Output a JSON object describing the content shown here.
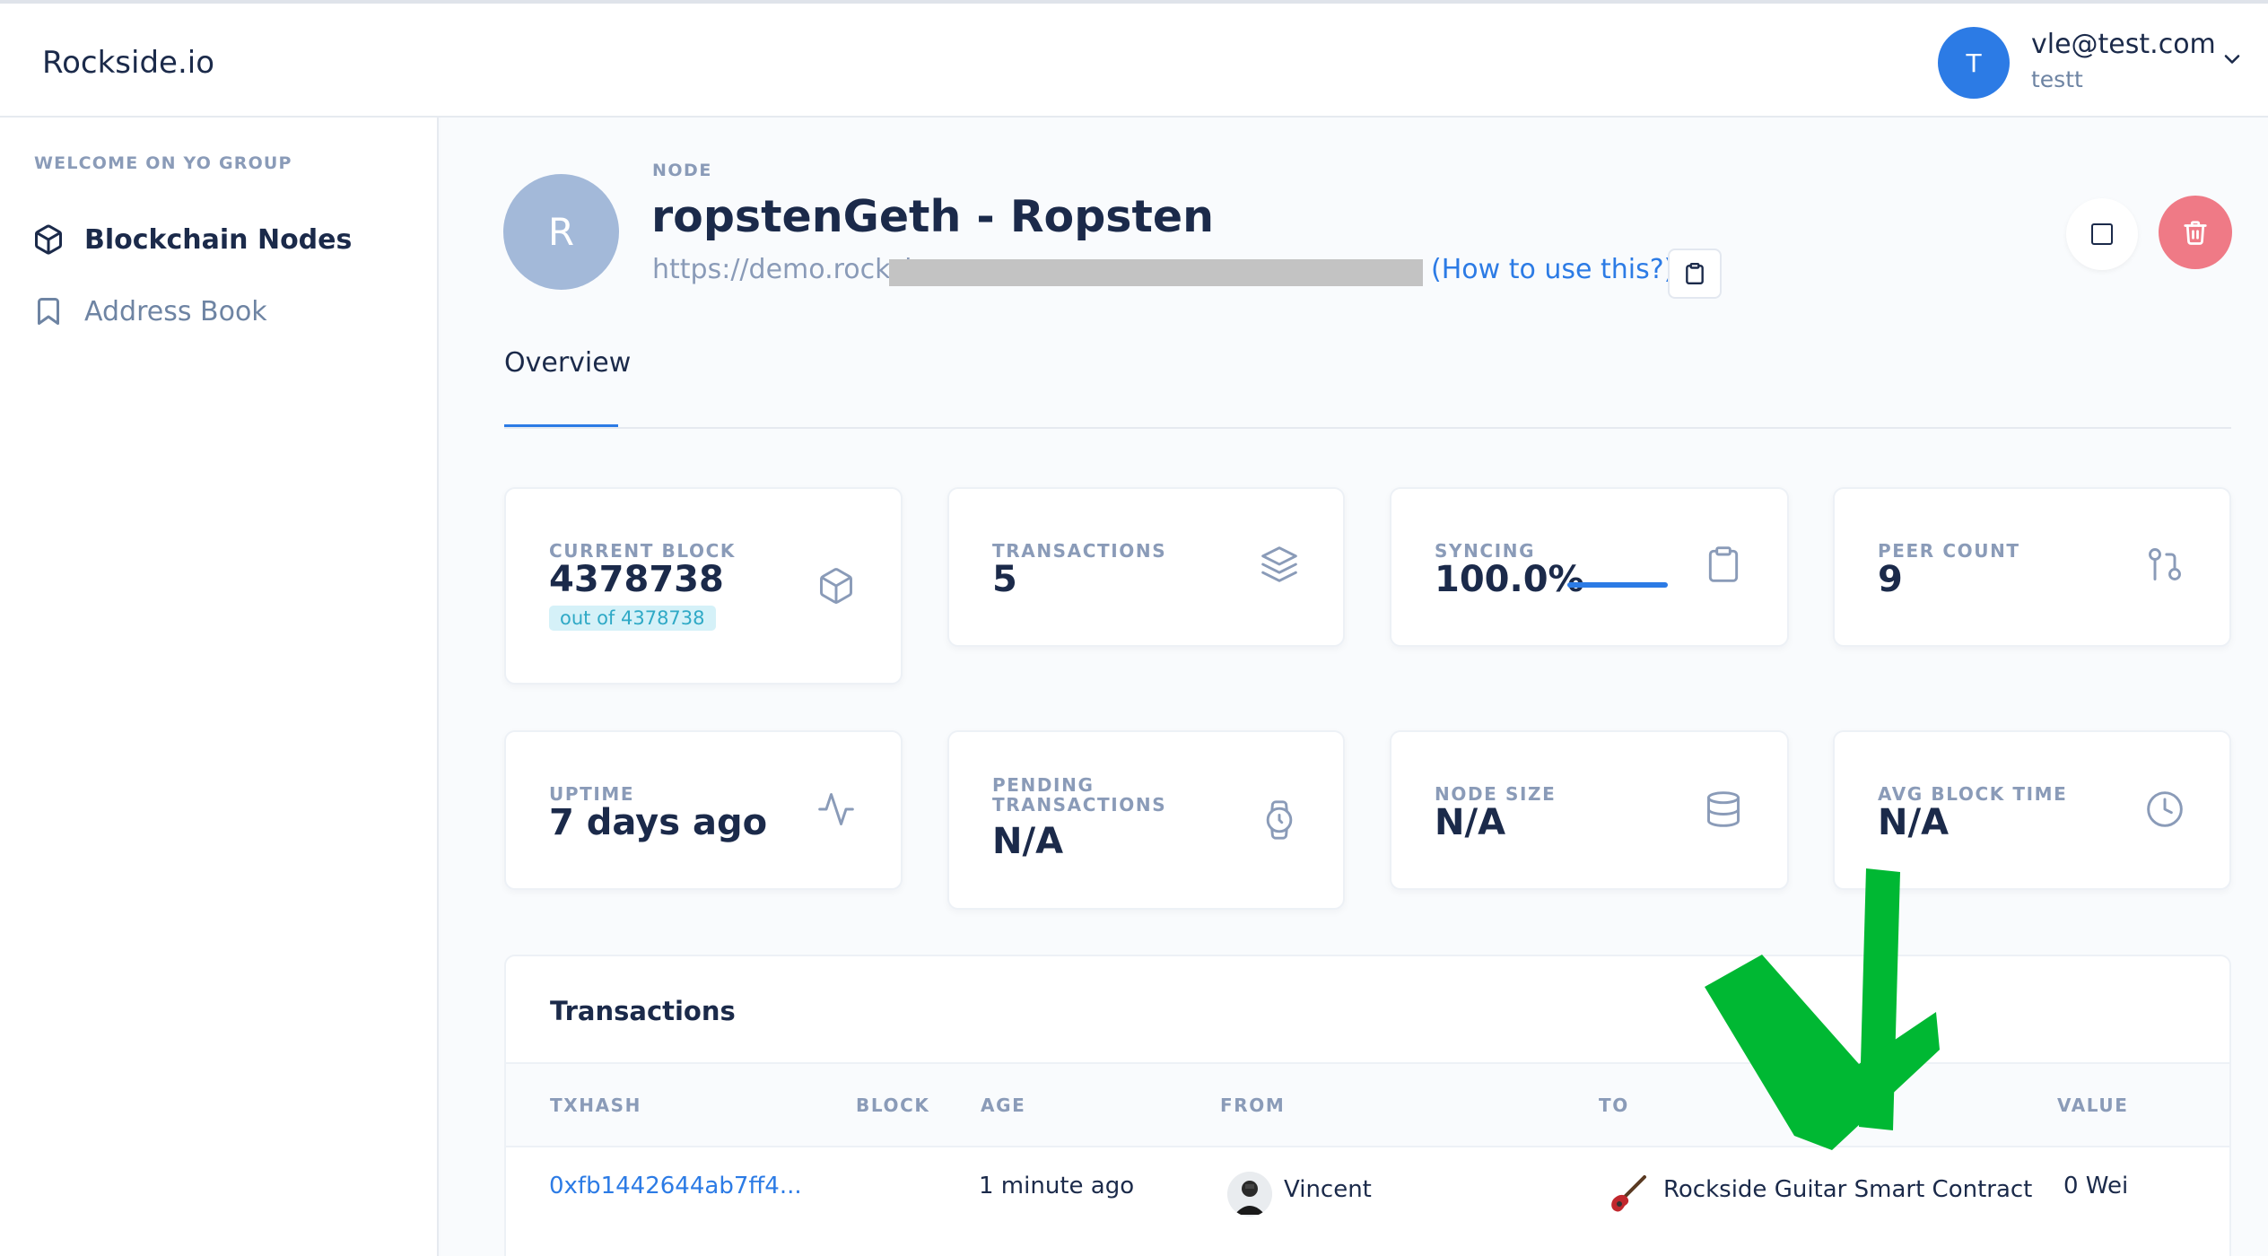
{
  "header": {
    "brand": "Rockside.io",
    "user_initial": "T",
    "user_email": "vle@test.com",
    "user_name": "testt",
    "chevron_icon": "chevron-down-icon"
  },
  "sidebar": {
    "heading": "WELCOME ON YO GROUP",
    "items": [
      {
        "label": "Blockchain Nodes",
        "icon": "cube-icon",
        "active": true
      },
      {
        "label": "Address Book",
        "icon": "bookmark-icon",
        "active": false
      }
    ]
  },
  "node": {
    "avatar_initial": "R",
    "label": "NODE",
    "title": "ropstenGeth - Ropsten",
    "url_visible": "https://demo.rocksi",
    "help_link": "(How to use this?)"
  },
  "tabs": [
    {
      "label": "Overview",
      "active": true
    }
  ],
  "stats": {
    "current_block": {
      "label": "CURRENT BLOCK",
      "value": "4378738",
      "badge": "out of 4378738",
      "icon": "cube-icon"
    },
    "transactions": {
      "label": "TRANSACTIONS",
      "value": "5",
      "icon": "layers-icon"
    },
    "syncing": {
      "label": "SYNCING",
      "value": "100.0%",
      "progress": 1.0,
      "icon": "clipboard-icon"
    },
    "peer_count": {
      "label": "PEER COUNT",
      "value": "9",
      "icon": "git-pull-request-icon"
    },
    "uptime": {
      "label": "UPTIME",
      "value": "7 days ago",
      "icon": "activity-icon"
    },
    "pending": {
      "label_line1": "PENDING",
      "label_line2": "TRANSACTIONS",
      "value": "N/A",
      "icon": "watch-icon"
    },
    "node_size": {
      "label": "NODE SIZE",
      "value": "N/A",
      "icon": "database-icon"
    },
    "avg_block_time": {
      "label": "AVG BLOCK TIME",
      "value": "N/A",
      "icon": "clock-icon"
    }
  },
  "transactions": {
    "title": "Transactions",
    "columns": [
      "TXHASH",
      "BLOCK",
      "AGE",
      "FROM",
      "TO",
      "VALUE"
    ],
    "rows": [
      {
        "txhash": "0xfb1442644ab7ff4...",
        "block": "",
        "age": "1 minute ago",
        "from": "Vincent",
        "to": "Rockside Guitar Smart Contract",
        "value": "0 Wei"
      }
    ]
  },
  "colors": {
    "accent": "#2c7be5",
    "danger": "#ef7a86",
    "badge_bg": "#d5f1f8",
    "badge_text": "#2fa9c6",
    "annotation_arrow": "#00b833"
  }
}
